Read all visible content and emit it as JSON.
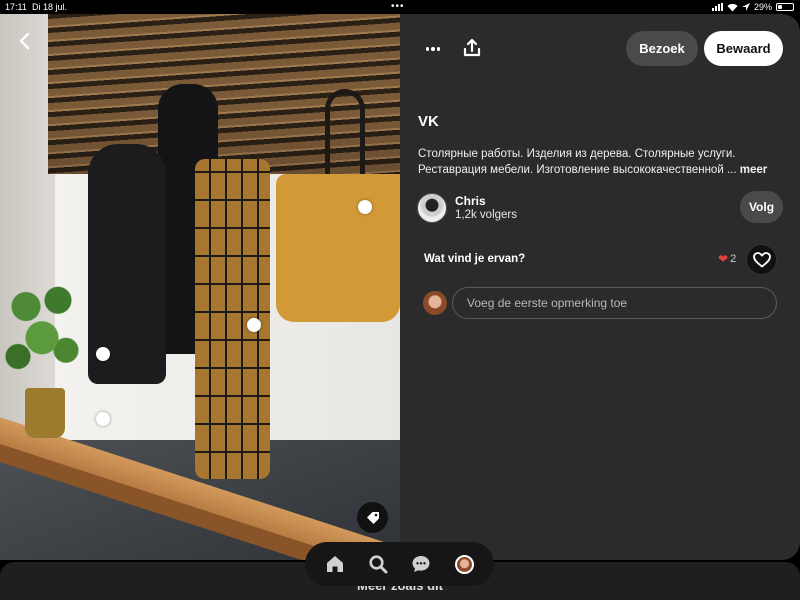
{
  "status_bar": {
    "time": "17:11",
    "date": "Di 18 jul.",
    "multitask_dots": "•••",
    "battery_percent": "29%",
    "battery_level": 0.29
  },
  "image": {
    "back_icon": "chevron-left-icon",
    "tag_icon": "tag-icon",
    "hotspot_count": 5
  },
  "header": {
    "more_icon": "more-horizontal-icon",
    "share_icon": "share-icon",
    "visit_label": "Bezoek",
    "save_label": "Bewaard"
  },
  "pin": {
    "title": "VK",
    "description": "Столярные работы. Изделия из дерева. Столярные услуги. Реставрация мебели. Изготовление высококачественной ...",
    "more_label": "meer"
  },
  "author": {
    "name": "Chris",
    "followers": "1,2k volgers",
    "follow_label": "Volg"
  },
  "reactions": {
    "question": "Wat vind je ervan?",
    "count": "2",
    "heart_color": "#e0433a"
  },
  "comment": {
    "placeholder": "Voeg de eerste opmerking toe"
  },
  "more_like_this": "Meer zoals dit",
  "tabbar": {
    "items": [
      "home-icon",
      "search-icon",
      "messages-icon",
      "profile-avatar"
    ]
  }
}
